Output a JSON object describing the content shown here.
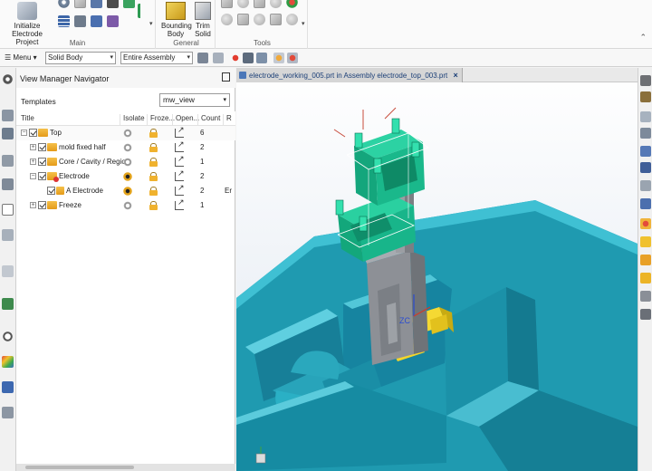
{
  "ribbon": {
    "initialize_label": "Initialize Electrode Project",
    "main_group": "Main",
    "bounding_body_label": "Bounding Body",
    "trim_solid_label": "Trim Solid",
    "general_group": "General",
    "tools_group": "Tools"
  },
  "cmdbar": {
    "menu_label": "Menu",
    "filter_value": "Solid Body",
    "scope_value": "Entire Assembly"
  },
  "navigator": {
    "title": "View Manager Navigator",
    "templates_label": "Templates",
    "template_value": "mw_view",
    "columns": [
      "Title",
      "Isolate",
      "Froze...",
      "Open...",
      "Count",
      "R"
    ],
    "rows": [
      {
        "title": "Top",
        "count": "6",
        "extra": ""
      },
      {
        "title": "mold fixed half",
        "count": "2",
        "extra": ""
      },
      {
        "title": "Core / Cavity / Region",
        "count": "1",
        "extra": ""
      },
      {
        "title": "Electrode",
        "count": "2",
        "extra": ""
      },
      {
        "title": "A Electrode",
        "count": "2",
        "extra": "Er"
      },
      {
        "title": "Freeze",
        "count": "1",
        "extra": ""
      }
    ]
  },
  "graphics": {
    "tab_title": "electrode_working_005.prt in Assembly electrode_top_003.prt",
    "tab_close": "×",
    "axis_label": "ZC"
  },
  "colors": {
    "mold_teal": "#1f9ab0",
    "electrode_green": "#18b58a",
    "electrode_grey": "#8d9096",
    "accent_yellow": "#f3d52b",
    "tab_text": "#1b3f77"
  }
}
